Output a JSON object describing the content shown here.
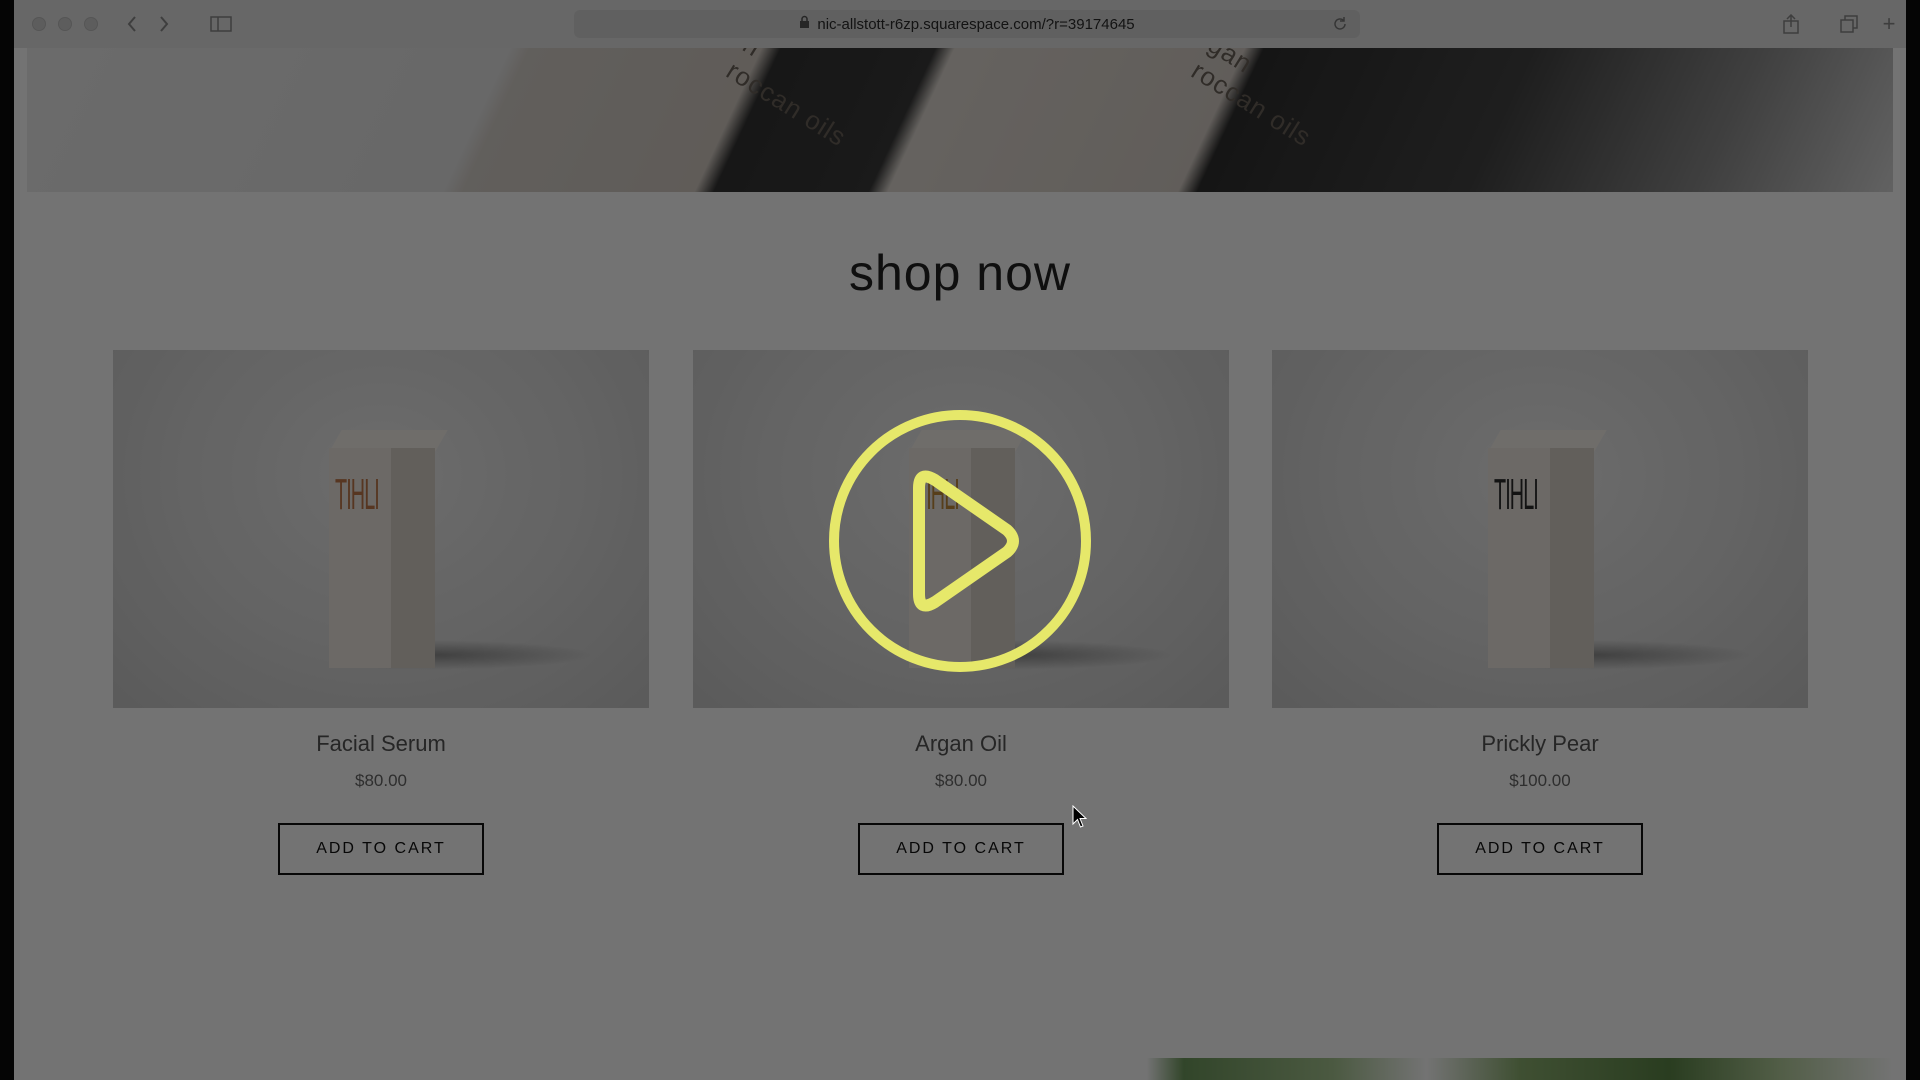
{
  "browser": {
    "url": "nic-allstott-r6zp.squarespace.com/?r=39174645"
  },
  "hero": {
    "text_left": "n\nroccan oils",
    "text_right": "gan\nroccan oils"
  },
  "shop": {
    "title": "shop now",
    "products": [
      {
        "name": "Facial Serum",
        "price": "$80.00",
        "button": "ADD TO CART",
        "brand": "TIHLI",
        "brand_color": "#c0784a"
      },
      {
        "name": "Argan Oil",
        "price": "$80.00",
        "button": "ADD TO CART",
        "brand": "TIHLI",
        "brand_color": "#c08a3a"
      },
      {
        "name": "Prickly Pear",
        "price": "$100.00",
        "button": "ADD TO CART",
        "brand": "TIHLI",
        "brand_color": "#2c2c2c"
      }
    ]
  },
  "overlay": {
    "play_color": "#e6e86a",
    "dim": true
  }
}
